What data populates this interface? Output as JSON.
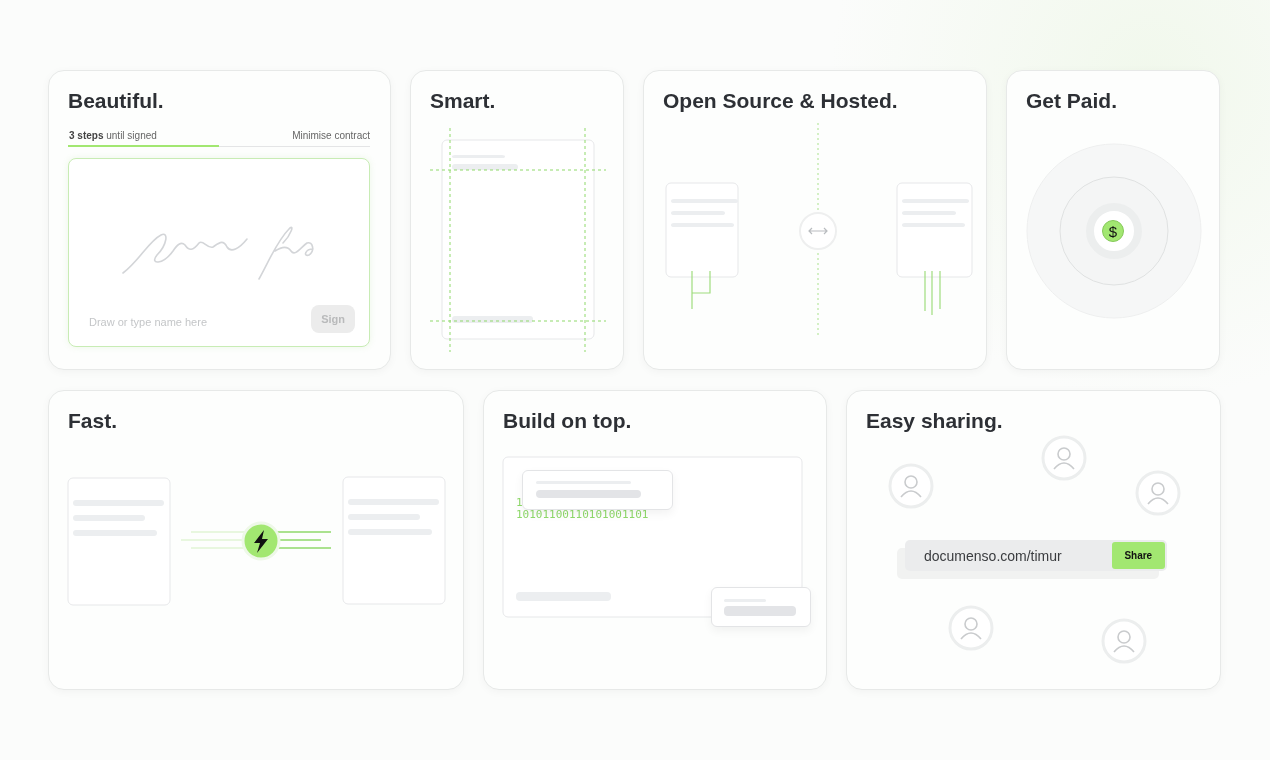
{
  "cards": [
    {
      "kind": "signature",
      "title": "Beautiful.",
      "steps": "**3 steps** until signed",
      "action": "Minimise contract",
      "progress": {
        "level": 0.5
      },
      "placeholder": "Draw or type name here",
      "button": {
        "label": "Sign",
        "disabled": true
      }
    },
    {
      "kind": "smart",
      "title": "Smart."
    },
    {
      "kind": "hosted",
      "title": "Open Source & Hosted."
    },
    {
      "kind": "paid",
      "title": "Get Paid.",
      "badge": "$"
    },
    {
      "kind": "fast",
      "title": "Fast."
    },
    {
      "kind": "build",
      "title": "Build on top.",
      "code_lines": [
        "1",
        "10101100110101001101"
      ]
    },
    {
      "kind": "sharing",
      "title": "Easy sharing.",
      "link": "documenso.com/timur",
      "button": "Share"
    }
  ]
}
